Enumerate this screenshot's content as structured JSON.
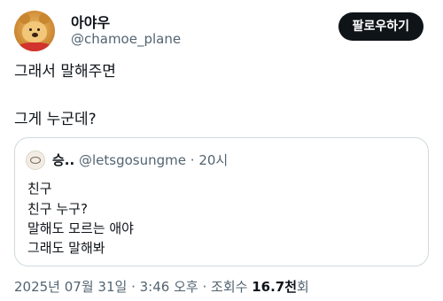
{
  "author": {
    "display_name": "아야우",
    "handle": "@chamoe_plane",
    "avatar": "winnie-the-pooh-avatar-icon"
  },
  "follow_button_label": "팔로우하기",
  "post": {
    "lines": [
      "그래서 말해주면",
      "그게 누군데?"
    ]
  },
  "quoted_post": {
    "display_name": "승..",
    "handle": "@letsgosungme",
    "separator": "·",
    "time": "20시",
    "lines": [
      "친구",
      "친구 누구?",
      "말해도 모르는 애야",
      "그래도 말해봐"
    ]
  },
  "meta": {
    "date": "2025년 07월 31일",
    "separator": "·",
    "time": "3:46 오후",
    "views_label": "조회수",
    "views_count": "16.7천",
    "views_suffix": "회"
  },
  "colors": {
    "text": "#0f1419",
    "secondary": "#536471",
    "border": "#cfd9de",
    "button_bg": "#0f1419",
    "button_text": "#ffffff"
  }
}
